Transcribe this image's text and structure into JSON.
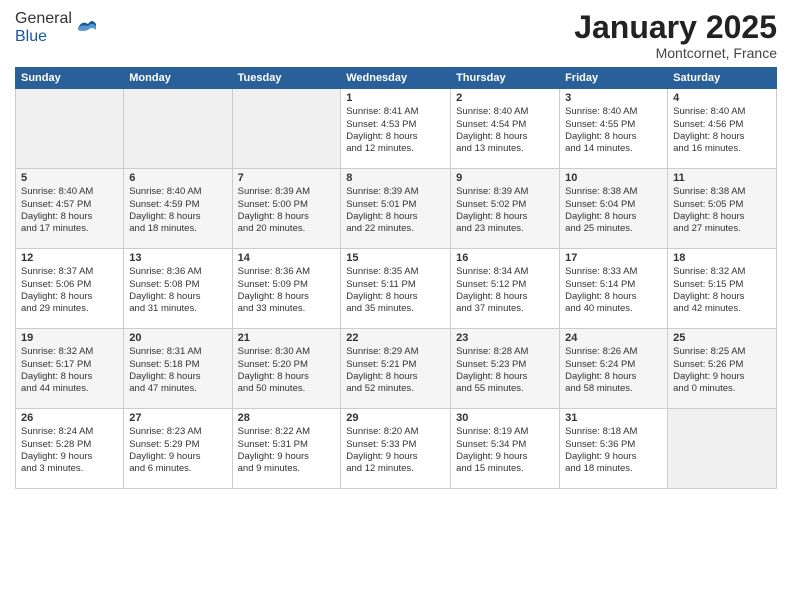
{
  "header": {
    "logo_general": "General",
    "logo_blue": "Blue",
    "month": "January 2025",
    "location": "Montcornet, France"
  },
  "days_of_week": [
    "Sunday",
    "Monday",
    "Tuesday",
    "Wednesday",
    "Thursday",
    "Friday",
    "Saturday"
  ],
  "weeks": [
    [
      {
        "day": "",
        "content": ""
      },
      {
        "day": "",
        "content": ""
      },
      {
        "day": "",
        "content": ""
      },
      {
        "day": "1",
        "content": "Sunrise: 8:41 AM\nSunset: 4:53 PM\nDaylight: 8 hours\nand 12 minutes."
      },
      {
        "day": "2",
        "content": "Sunrise: 8:40 AM\nSunset: 4:54 PM\nDaylight: 8 hours\nand 13 minutes."
      },
      {
        "day": "3",
        "content": "Sunrise: 8:40 AM\nSunset: 4:55 PM\nDaylight: 8 hours\nand 14 minutes."
      },
      {
        "day": "4",
        "content": "Sunrise: 8:40 AM\nSunset: 4:56 PM\nDaylight: 8 hours\nand 16 minutes."
      }
    ],
    [
      {
        "day": "5",
        "content": "Sunrise: 8:40 AM\nSunset: 4:57 PM\nDaylight: 8 hours\nand 17 minutes."
      },
      {
        "day": "6",
        "content": "Sunrise: 8:40 AM\nSunset: 4:59 PM\nDaylight: 8 hours\nand 18 minutes."
      },
      {
        "day": "7",
        "content": "Sunrise: 8:39 AM\nSunset: 5:00 PM\nDaylight: 8 hours\nand 20 minutes."
      },
      {
        "day": "8",
        "content": "Sunrise: 8:39 AM\nSunset: 5:01 PM\nDaylight: 8 hours\nand 22 minutes."
      },
      {
        "day": "9",
        "content": "Sunrise: 8:39 AM\nSunset: 5:02 PM\nDaylight: 8 hours\nand 23 minutes."
      },
      {
        "day": "10",
        "content": "Sunrise: 8:38 AM\nSunset: 5:04 PM\nDaylight: 8 hours\nand 25 minutes."
      },
      {
        "day": "11",
        "content": "Sunrise: 8:38 AM\nSunset: 5:05 PM\nDaylight: 8 hours\nand 27 minutes."
      }
    ],
    [
      {
        "day": "12",
        "content": "Sunrise: 8:37 AM\nSunset: 5:06 PM\nDaylight: 8 hours\nand 29 minutes."
      },
      {
        "day": "13",
        "content": "Sunrise: 8:36 AM\nSunset: 5:08 PM\nDaylight: 8 hours\nand 31 minutes."
      },
      {
        "day": "14",
        "content": "Sunrise: 8:36 AM\nSunset: 5:09 PM\nDaylight: 8 hours\nand 33 minutes."
      },
      {
        "day": "15",
        "content": "Sunrise: 8:35 AM\nSunset: 5:11 PM\nDaylight: 8 hours\nand 35 minutes."
      },
      {
        "day": "16",
        "content": "Sunrise: 8:34 AM\nSunset: 5:12 PM\nDaylight: 8 hours\nand 37 minutes."
      },
      {
        "day": "17",
        "content": "Sunrise: 8:33 AM\nSunset: 5:14 PM\nDaylight: 8 hours\nand 40 minutes."
      },
      {
        "day": "18",
        "content": "Sunrise: 8:32 AM\nSunset: 5:15 PM\nDaylight: 8 hours\nand 42 minutes."
      }
    ],
    [
      {
        "day": "19",
        "content": "Sunrise: 8:32 AM\nSunset: 5:17 PM\nDaylight: 8 hours\nand 44 minutes."
      },
      {
        "day": "20",
        "content": "Sunrise: 8:31 AM\nSunset: 5:18 PM\nDaylight: 8 hours\nand 47 minutes."
      },
      {
        "day": "21",
        "content": "Sunrise: 8:30 AM\nSunset: 5:20 PM\nDaylight: 8 hours\nand 50 minutes."
      },
      {
        "day": "22",
        "content": "Sunrise: 8:29 AM\nSunset: 5:21 PM\nDaylight: 8 hours\nand 52 minutes."
      },
      {
        "day": "23",
        "content": "Sunrise: 8:28 AM\nSunset: 5:23 PM\nDaylight: 8 hours\nand 55 minutes."
      },
      {
        "day": "24",
        "content": "Sunrise: 8:26 AM\nSunset: 5:24 PM\nDaylight: 8 hours\nand 58 minutes."
      },
      {
        "day": "25",
        "content": "Sunrise: 8:25 AM\nSunset: 5:26 PM\nDaylight: 9 hours\nand 0 minutes."
      }
    ],
    [
      {
        "day": "26",
        "content": "Sunrise: 8:24 AM\nSunset: 5:28 PM\nDaylight: 9 hours\nand 3 minutes."
      },
      {
        "day": "27",
        "content": "Sunrise: 8:23 AM\nSunset: 5:29 PM\nDaylight: 9 hours\nand 6 minutes."
      },
      {
        "day": "28",
        "content": "Sunrise: 8:22 AM\nSunset: 5:31 PM\nDaylight: 9 hours\nand 9 minutes."
      },
      {
        "day": "29",
        "content": "Sunrise: 8:20 AM\nSunset: 5:33 PM\nDaylight: 9 hours\nand 12 minutes."
      },
      {
        "day": "30",
        "content": "Sunrise: 8:19 AM\nSunset: 5:34 PM\nDaylight: 9 hours\nand 15 minutes."
      },
      {
        "day": "31",
        "content": "Sunrise: 8:18 AM\nSunset: 5:36 PM\nDaylight: 9 hours\nand 18 minutes."
      },
      {
        "day": "",
        "content": ""
      }
    ]
  ]
}
